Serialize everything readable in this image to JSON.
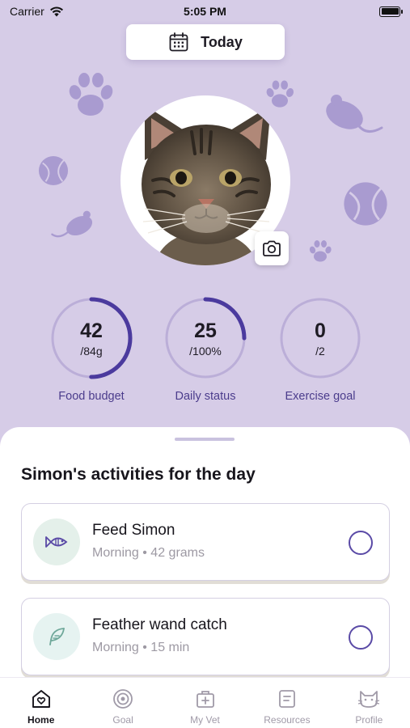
{
  "status_bar": {
    "carrier": "Carrier",
    "time": "5:05 PM"
  },
  "header": {
    "date_label": "Today"
  },
  "stats": [
    {
      "value": "42",
      "sub": "/84g",
      "label": "Food budget",
      "progress": 0.5
    },
    {
      "value": "25",
      "sub": "/100%",
      "label": "Daily status",
      "progress": 0.25
    },
    {
      "value": "0",
      "sub": "/2",
      "label": "Exercise goal",
      "progress": 0
    }
  ],
  "activities": {
    "title": "Simon's activities for the day",
    "items": [
      {
        "title": "Feed Simon",
        "subtitle": "Morning • 42 grams",
        "icon": "fish-icon",
        "checked": false
      },
      {
        "title": "Feather wand catch",
        "subtitle": "Morning • 15 min",
        "icon": "feather-icon",
        "checked": false
      }
    ]
  },
  "tabbar": [
    {
      "label": "Home",
      "icon": "home-heart-icon",
      "active": true
    },
    {
      "label": "Goal",
      "icon": "target-icon",
      "active": false
    },
    {
      "label": "My Vet",
      "icon": "medical-bag-icon",
      "active": false
    },
    {
      "label": "Resources",
      "icon": "document-icon",
      "active": false
    },
    {
      "label": "Profile",
      "icon": "cat-face-icon",
      "active": false
    }
  ],
  "colors": {
    "background": "#d6cce7",
    "accent": "#4b3a9e",
    "ring_track": "#bbaed8",
    "label": "#4b3c8c",
    "decoration": "#a99bd0"
  }
}
